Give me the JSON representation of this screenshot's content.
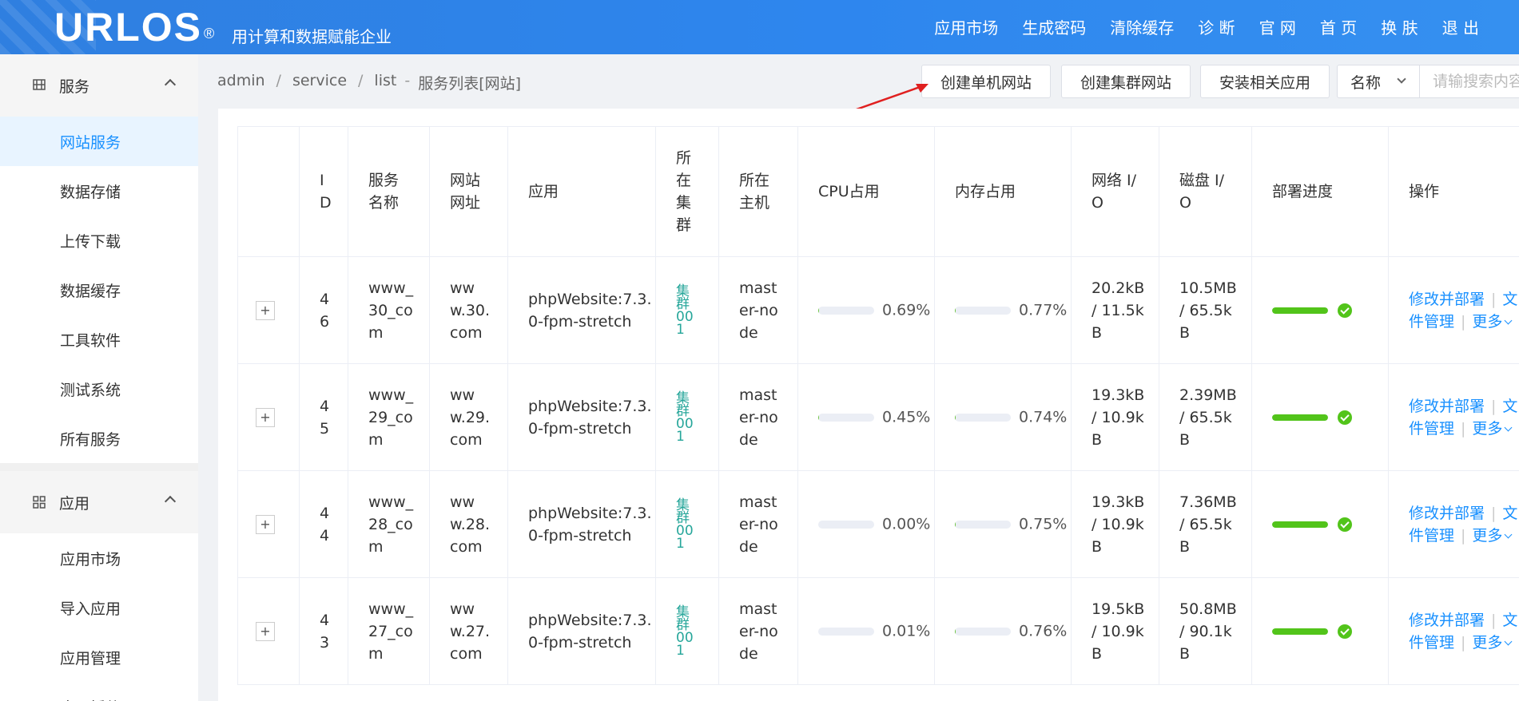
{
  "header": {
    "logo": "URLOS",
    "logo_mark": "®",
    "tagline": "用计算和数据赋能企业",
    "nav": [
      "应用市场",
      "生成密码",
      "清除缓存",
      "诊 断",
      "官 网",
      "首 页",
      "换 肤",
      "退 出"
    ]
  },
  "sidebar": {
    "groups": [
      {
        "label": "服务",
        "icon": "service-icon",
        "items": [
          "网站服务",
          "数据存储",
          "上传下载",
          "数据缓存",
          "工具软件",
          "测试系统",
          "所有服务"
        ]
      },
      {
        "label": "应用",
        "icon": "apps-grid-icon",
        "items": [
          "应用市场",
          "导入应用",
          "应用管理",
          "应用插件"
        ]
      }
    ],
    "active_item": "网站服务"
  },
  "breadcrumb": {
    "items": [
      "admin",
      "service",
      "list"
    ],
    "dash": "-",
    "current": "服务列表[网站]"
  },
  "toolbar": {
    "create_single": "创建单机网站",
    "create_cluster": "创建集群网站",
    "install_related": "安装相关应用",
    "search_field": "名称",
    "search_placeholder": "请输搜索内容"
  },
  "table": {
    "headers": [
      "",
      "I\nD",
      "服务\n名称",
      "网站\n网址",
      "应用",
      "所\n在\n集\n群",
      "所在\n主机",
      "CPU占用",
      "内存占用",
      "网络 I/\nO",
      "磁盘 I/\nO",
      "部署进度",
      "操作"
    ],
    "expand_symbol": "+",
    "ops": {
      "edit_deploy": "修改并部署",
      "file_manage_a": "文",
      "file_manage_b": "件管理",
      "more": "更多"
    },
    "rows": [
      {
        "id": "4\n6",
        "name": "www_\n30_co\nm",
        "url": "ww\nw.30.\ncom",
        "app": "phpWebsite:7.3.\n0-fpm-stretch",
        "cluster": "集\n群\n00\n1",
        "host": "mast\ner-no\nde",
        "cpu": "0.69%",
        "cpu_value": 0.69,
        "mem": "0.77%",
        "mem_value": 0.77,
        "net": "20.2kB\n/ 11.5k\nB",
        "disk": "10.5MB\n/ 65.5k\nB",
        "deploy_progress": 100
      },
      {
        "id": "4\n5",
        "name": "www_\n29_co\nm",
        "url": "ww\nw.29.\ncom",
        "app": "phpWebsite:7.3.\n0-fpm-stretch",
        "cluster": "集\n群\n00\n1",
        "host": "mast\ner-no\nde",
        "cpu": "0.45%",
        "cpu_value": 0.45,
        "mem": "0.74%",
        "mem_value": 0.74,
        "net": "19.3kB\n/ 10.9k\nB",
        "disk": "2.39MB\n/ 65.5k\nB",
        "deploy_progress": 100
      },
      {
        "id": "4\n4",
        "name": "www_\n28_co\nm",
        "url": "ww\nw.28.\ncom",
        "app": "phpWebsite:7.3.\n0-fpm-stretch",
        "cluster": "集\n群\n00\n1",
        "host": "mast\ner-no\nde",
        "cpu": "0.00%",
        "cpu_value": 0.0,
        "mem": "0.75%",
        "mem_value": 0.75,
        "net": "19.3kB\n/ 10.9k\nB",
        "disk": "7.36MB\n/ 65.5k\nB",
        "deploy_progress": 100
      },
      {
        "id": "4\n3",
        "name": "www_\n27_co\nm",
        "url": "ww\nw.27.\ncom",
        "app": "phpWebsite:7.3.\n0-fpm-stretch",
        "cluster": "集\n群\n00\n1",
        "host": "mast\ner-no\nde",
        "cpu": "0.01%",
        "cpu_value": 0.01,
        "mem": "0.76%",
        "mem_value": 0.76,
        "net": "19.5kB\n/ 10.9k\nB",
        "disk": "50.8MB\n/ 90.1k\nB",
        "deploy_progress": 100
      }
    ]
  },
  "colors": {
    "header_blue": "#2e86ee",
    "active_bg": "#e8f4ff",
    "link_blue": "#1890ff",
    "cluster_teal": "#26a69a",
    "deploy_green": "#52c41a",
    "arrow_red": "#e02020"
  }
}
